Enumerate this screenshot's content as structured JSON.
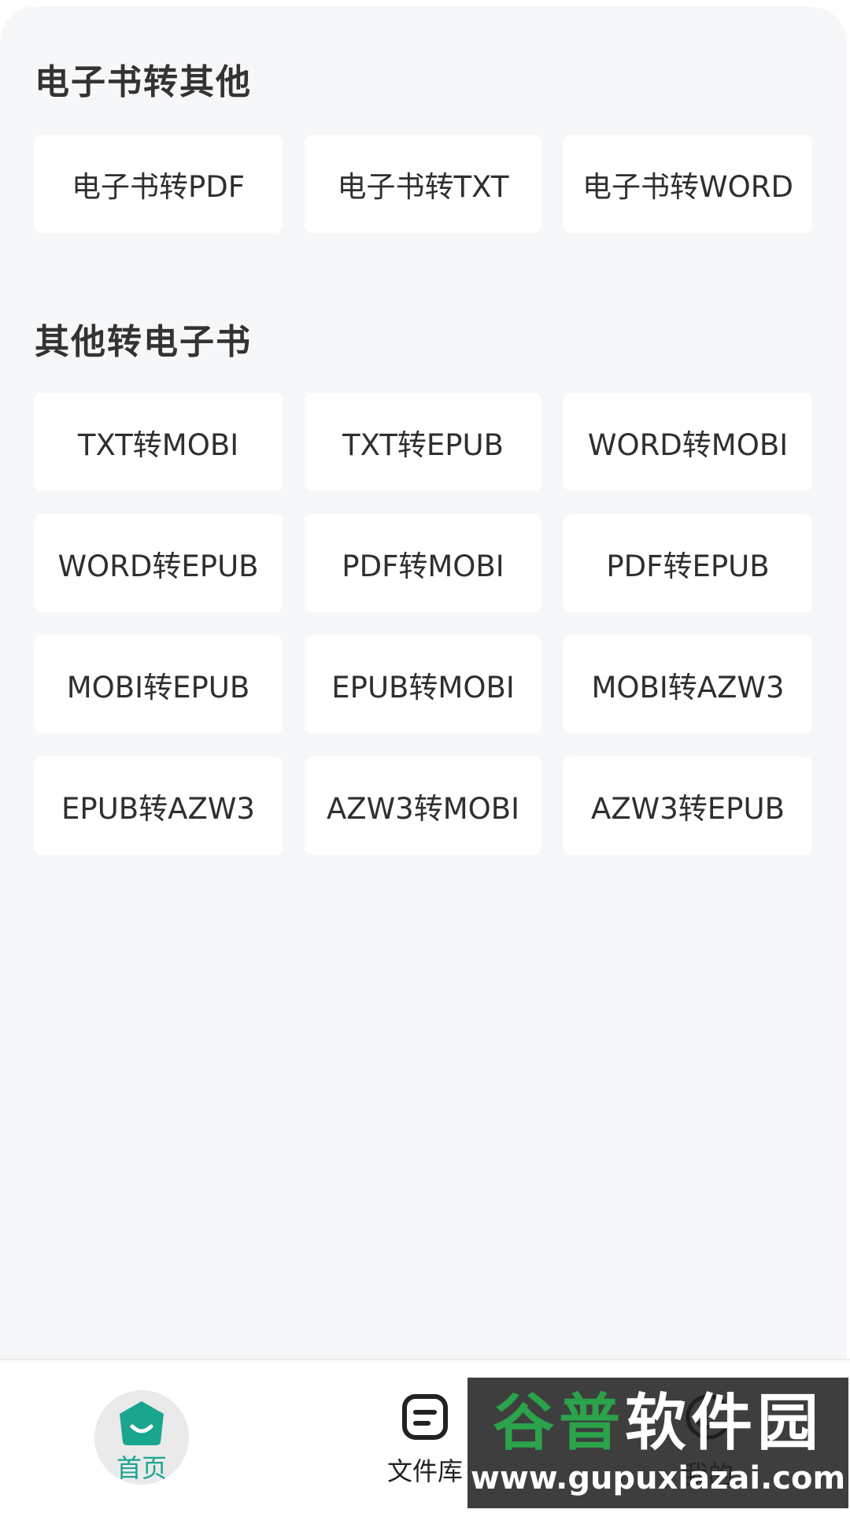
{
  "sections": [
    {
      "title": "电子书转其他",
      "items": [
        "电子书转PDF",
        "电子书转TXT",
        "电子书转WORD"
      ]
    },
    {
      "title": "其他转电子书",
      "items": [
        "TXT转MOBI",
        "TXT转EPUB",
        "WORD转MOBI",
        "WORD转EPUB",
        "PDF转MOBI",
        "PDF转EPUB",
        "MOBI转EPUB",
        "EPUB转MOBI",
        "MOBI转AZW3",
        "EPUB转AZW3",
        "AZW3转MOBI",
        "AZW3转EPUB"
      ]
    }
  ],
  "nav": {
    "items": [
      {
        "label": "首页",
        "icon": "home-icon",
        "active": true
      },
      {
        "label": "文件库",
        "icon": "file-library-icon",
        "active": false
      },
      {
        "label": "我的",
        "icon": "profile-icon",
        "active": false
      }
    ]
  },
  "watermark": {
    "brand_part1": "谷普",
    "brand_part2": "软件园",
    "url": "www.gupuxiazai.com"
  },
  "colors": {
    "accent": "#1aa58f",
    "background": "#f6f7f9",
    "tile": "#ffffff"
  }
}
